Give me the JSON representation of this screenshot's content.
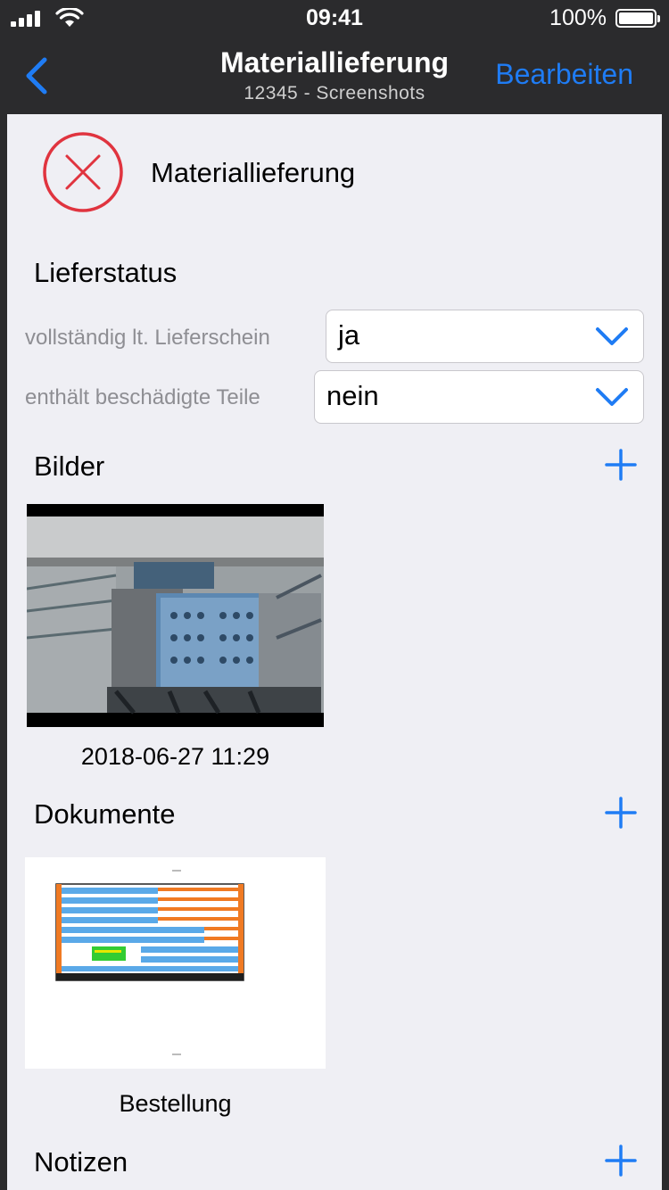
{
  "status_bar": {
    "time": "09:41",
    "battery": "100%"
  },
  "nav": {
    "title": "Materiallieferung",
    "subtitle": "12345 - Screenshots",
    "edit_label": "Bearbeiten"
  },
  "header": {
    "title": "Materiallieferung"
  },
  "delivery_status": {
    "title": "Lieferstatus",
    "fields": [
      {
        "label": "vollständig lt. Lieferschein",
        "value": "ja"
      },
      {
        "label": "enthält beschädigte Teile",
        "value": "nein"
      }
    ]
  },
  "images": {
    "title": "Bilder",
    "items": [
      {
        "caption": "2018-06-27 11:29"
      }
    ]
  },
  "documents": {
    "title": "Dokumente",
    "items": [
      {
        "caption": "Bestellung"
      }
    ]
  },
  "notes": {
    "title": "Notizen"
  },
  "colors": {
    "accent": "#1f7cf4",
    "error": "#e0343f",
    "nav_bg": "#2b2b2d",
    "content_bg": "#efeff4"
  }
}
